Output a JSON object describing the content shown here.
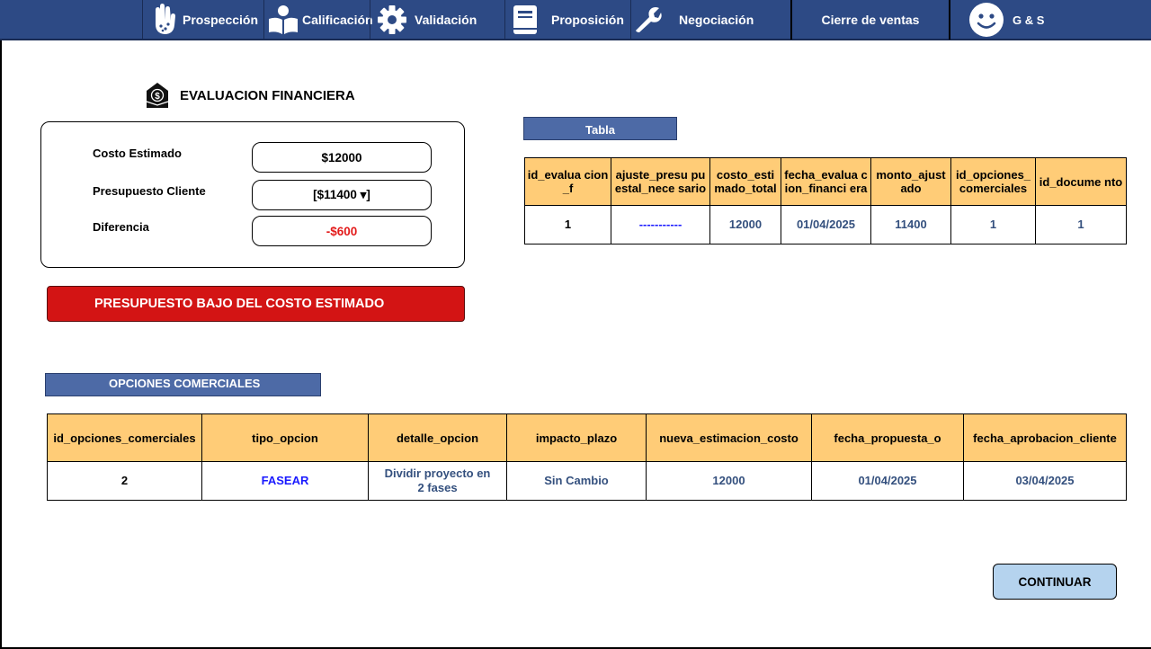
{
  "nav": {
    "items": [
      {
        "label": "Prospección",
        "icon": "hand-icon"
      },
      {
        "label": "Calificación",
        "icon": "reader-icon"
      },
      {
        "label": "Validación",
        "icon": "gear-icon"
      },
      {
        "label": "Proposición",
        "icon": "book-icon"
      },
      {
        "label": "Negociación",
        "icon": "wrench-icon"
      },
      {
        "label": "Cierre de ventas",
        "icon": ""
      }
    ],
    "user_label": "G & S",
    "user_icon": "smiley-icon"
  },
  "evaluation": {
    "title": "EVALUACION FINANCIERA",
    "icon": "money-envelope-icon",
    "fields": {
      "costo_label": "Costo Estimado",
      "costo_value": "$12000",
      "presupuesto_label": "Presupuesto Cliente",
      "presupuesto_value": "[$11400 ▾]",
      "diferencia_label": "Diferencia",
      "diferencia_value": "-$600"
    },
    "alert": "PRESUPUESTO BAJO DEL COSTO ESTIMADO"
  },
  "tabla": {
    "label": "Tabla",
    "headers": [
      "id_evalua cion_f",
      "ajuste_presu puestal_nece sario",
      "costo_esti mado_total",
      "fecha_evalua cion_financi era",
      "monto_ajust ado",
      "id_opciones_ comerciales",
      "id_docume nto"
    ],
    "row": [
      "1",
      "-----------",
      "12000",
      "01/04/2025",
      "11400",
      "1",
      "1"
    ]
  },
  "opciones": {
    "label": "OPCIONES COMERCIALES",
    "headers": [
      "id_opciones_comerciales",
      "tipo_opcion",
      "detalle_opcion",
      "impacto_plazo",
      "nueva_estimacion_costo",
      "fecha_propuesta_o",
      "fecha_aprobacion_cliente"
    ],
    "row": [
      "2",
      "FASEAR",
      "Dividir proyecto en 2 fases",
      "Sin Cambio",
      "12000",
      "01/04/2025",
      "03/04/2025"
    ]
  },
  "continue_label": "CONTINUAR",
  "colors": {
    "nav_bg": "#2d4a85",
    "header_bg": "#ffcc77",
    "alert_bg": "#d31414",
    "diferencia_text": "#e31b1b",
    "link_blue": "#1a1aff",
    "value_blue": "#34507e",
    "button_bg": "#b5d3ee"
  }
}
